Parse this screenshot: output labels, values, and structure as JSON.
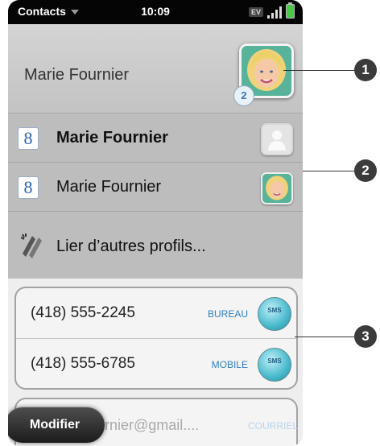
{
  "status_bar": {
    "app_name": "Contacts",
    "time": "10:09",
    "network": "EV"
  },
  "header": {
    "name": "Marie Fournier",
    "profile_count": "2"
  },
  "profiles": [
    {
      "source_icon": "google-icon",
      "name": "Marie Fournier",
      "bold": true,
      "avatar": "placeholder"
    },
    {
      "source_icon": "google-icon",
      "name": "Marie Fournier",
      "bold": false,
      "avatar": "photo"
    }
  ],
  "link_profiles": {
    "label": "Lier d’autres profils..."
  },
  "phones": [
    {
      "number": "(418) 555-2245",
      "type": "BUREAU",
      "action": "SMS"
    },
    {
      "number": "(418) 555-6785",
      "type": "MOBILE",
      "action": "SMS"
    }
  ],
  "email": {
    "value": "urnier@gmail....",
    "type": "COURRIEL"
  },
  "modify_button": {
    "label": "Modifier"
  },
  "callouts": [
    "1",
    "2",
    "3"
  ],
  "colors": {
    "link_blue": "#2f7fc4",
    "sms_teal": "#48b9cc",
    "battery_green": "#4ac84a"
  }
}
